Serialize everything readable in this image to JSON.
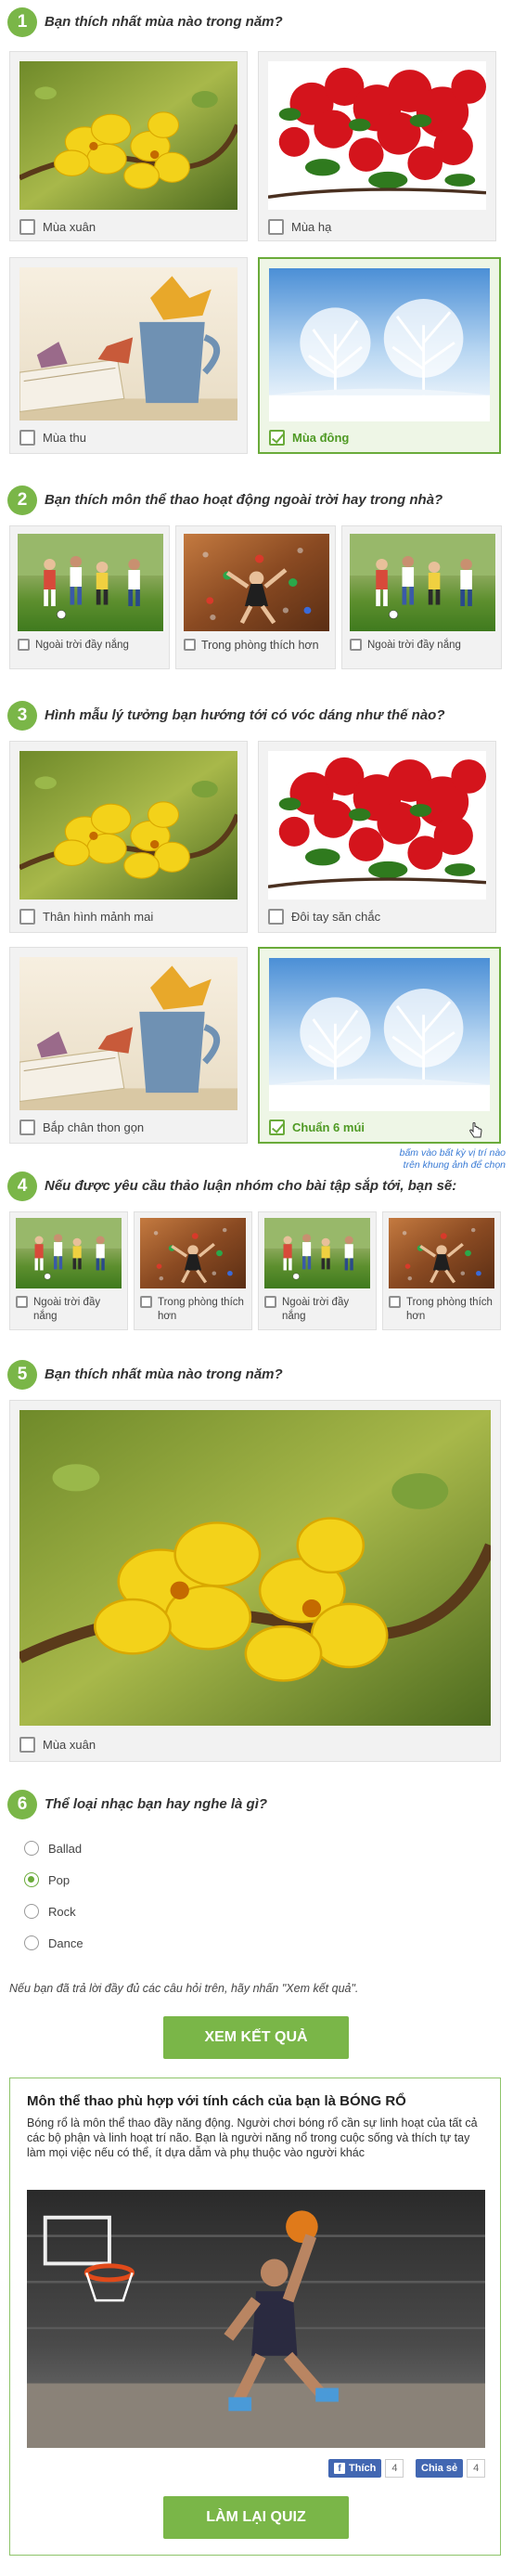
{
  "q1": {
    "num": "1",
    "text": "Bạn thích nhất mùa nào trong năm?",
    "options": [
      "Mùa xuân",
      "Mùa hạ",
      "Mùa thu",
      "Mùa đông"
    ]
  },
  "q2": {
    "num": "2",
    "text": "Bạn thích môn thể thao hoạt động ngoài trời hay trong nhà?",
    "options": [
      "Ngoài trời đầy nắng",
      "Trong phòng thích hơn",
      "Ngoài trời đầy nắng"
    ]
  },
  "q3": {
    "num": "3",
    "text": "Hình mẫu lý tưởng bạn hướng tới có vóc dáng như thế nào?",
    "options": [
      "Thân hình mảnh mai",
      "Đôi tay săn chắc",
      "Bắp chân thon gọn",
      "Chuẩn 6 múi"
    ],
    "hint_line1": "bấm vào bất kỳ vị trí nào",
    "hint_line2": "trên khung ảnh để chọn"
  },
  "q4": {
    "num": "4",
    "text": "Nếu được yêu cầu thảo luận nhóm cho bài tập sắp tới, bạn sẽ:",
    "options": [
      "Ngoài trời đầy nắng",
      "Trong phòng thích hơn",
      "Ngoài trời đầy nắng",
      "Trong phòng thích hơn"
    ]
  },
  "q5": {
    "num": "5",
    "text": "Bạn thích nhất mùa nào trong năm?",
    "options": [
      "Mùa xuân"
    ]
  },
  "q6": {
    "num": "6",
    "text": "Thể loại nhạc bạn hay nghe là gì?",
    "options": [
      "Ballad",
      "Pop",
      "Rock",
      "Dance"
    ],
    "selected": "Pop"
  },
  "instruction": "Nếu bạn đã trả lời đầy đủ các câu hỏi trên, hãy nhấn \"Xem kết quả\".",
  "result_button": "XEM KẾT QUẢ",
  "result": {
    "title": "Môn thể thao phù hợp với tính cách của bạn là BÓNG RỔ",
    "description": "Bóng rổ là môn thể thao đầy năng động. Người chơi bóng rổ cần sự linh hoạt của tất cả các bộ phận và linh hoạt trí não. Bạn là người năng nổ trong cuộc sống và thích tự tay làm mọi việc nếu có thể, ít dựa dẫm và phụ thuộc vào người khác",
    "like_label": "Thích",
    "like_count": "4",
    "share_label": "Chia sẻ",
    "share_count": "4",
    "retry_button": "LÀM LẠI QUIZ"
  }
}
